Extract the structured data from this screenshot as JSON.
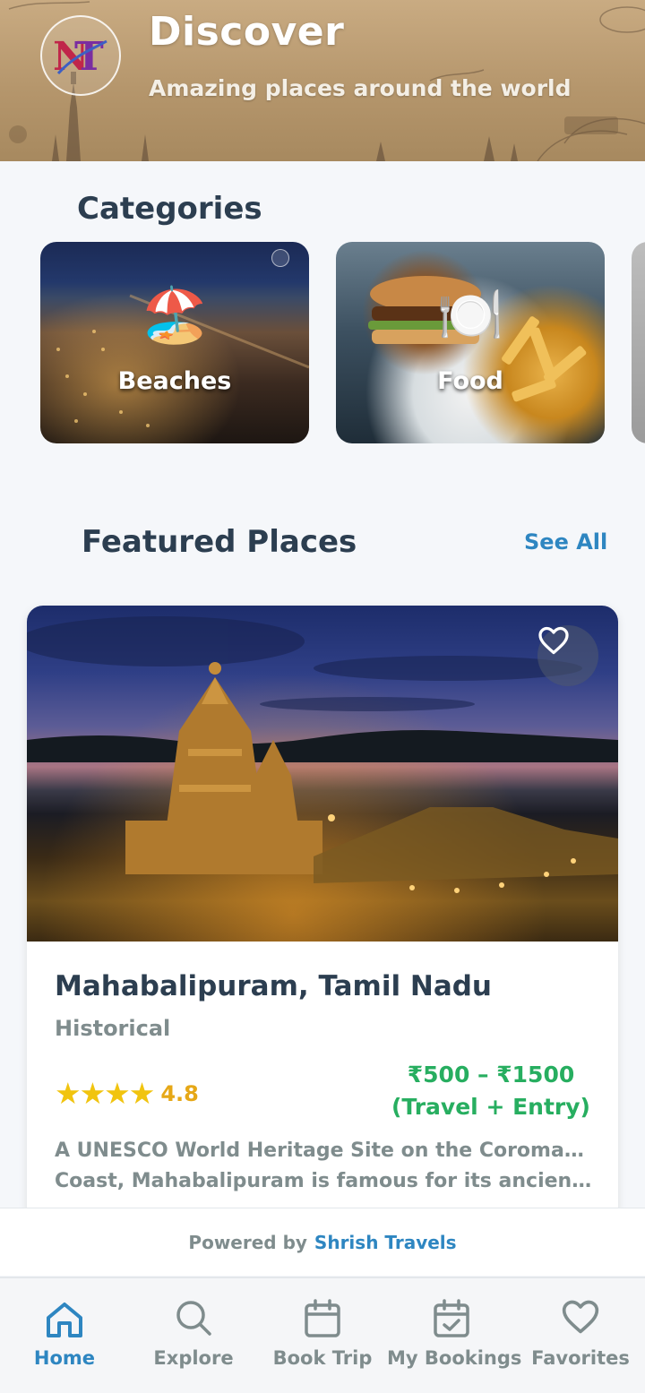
{
  "header": {
    "title": "Discover",
    "subtitle": "Amazing places around the world",
    "logo_text": "NT"
  },
  "categories": {
    "title": "Categories",
    "items": [
      {
        "label": "Beaches",
        "emoji": "🏖️"
      },
      {
        "label": "Food",
        "emoji": "🍽️"
      }
    ]
  },
  "featured": {
    "title": "Featured Places",
    "see_all_label": "See All",
    "place": {
      "name": "Mahabalipuram, Tamil Nadu",
      "category": "Historical",
      "stars": "★★★★",
      "rating": "4.8",
      "price_range": "₹500 – ₹1500",
      "price_note": "(Travel + Entry)",
      "description_line1": "A UNESCO World Heritage Site on the Coromandel",
      "description_line2": "Coast, Mahabalipuram is famous for its ancient r…"
    }
  },
  "footer": {
    "powered_prefix": "Powered by",
    "powered_brand": "Shrish Travels"
  },
  "nav": {
    "items": [
      {
        "label": "Home",
        "icon": "home-icon",
        "active": true
      },
      {
        "label": "Explore",
        "icon": "search-icon",
        "active": false
      },
      {
        "label": "Book Trip",
        "icon": "calendar-icon",
        "active": false
      },
      {
        "label": "My Bookings",
        "icon": "calendar-check-icon",
        "active": false
      },
      {
        "label": "Favorites",
        "icon": "heart-icon",
        "active": false
      }
    ]
  },
  "colors": {
    "primary": "#2e86c1",
    "heading": "#2c3e50",
    "muted": "#7f8c8d",
    "price": "#27ae60",
    "rating": "#e6a817"
  }
}
